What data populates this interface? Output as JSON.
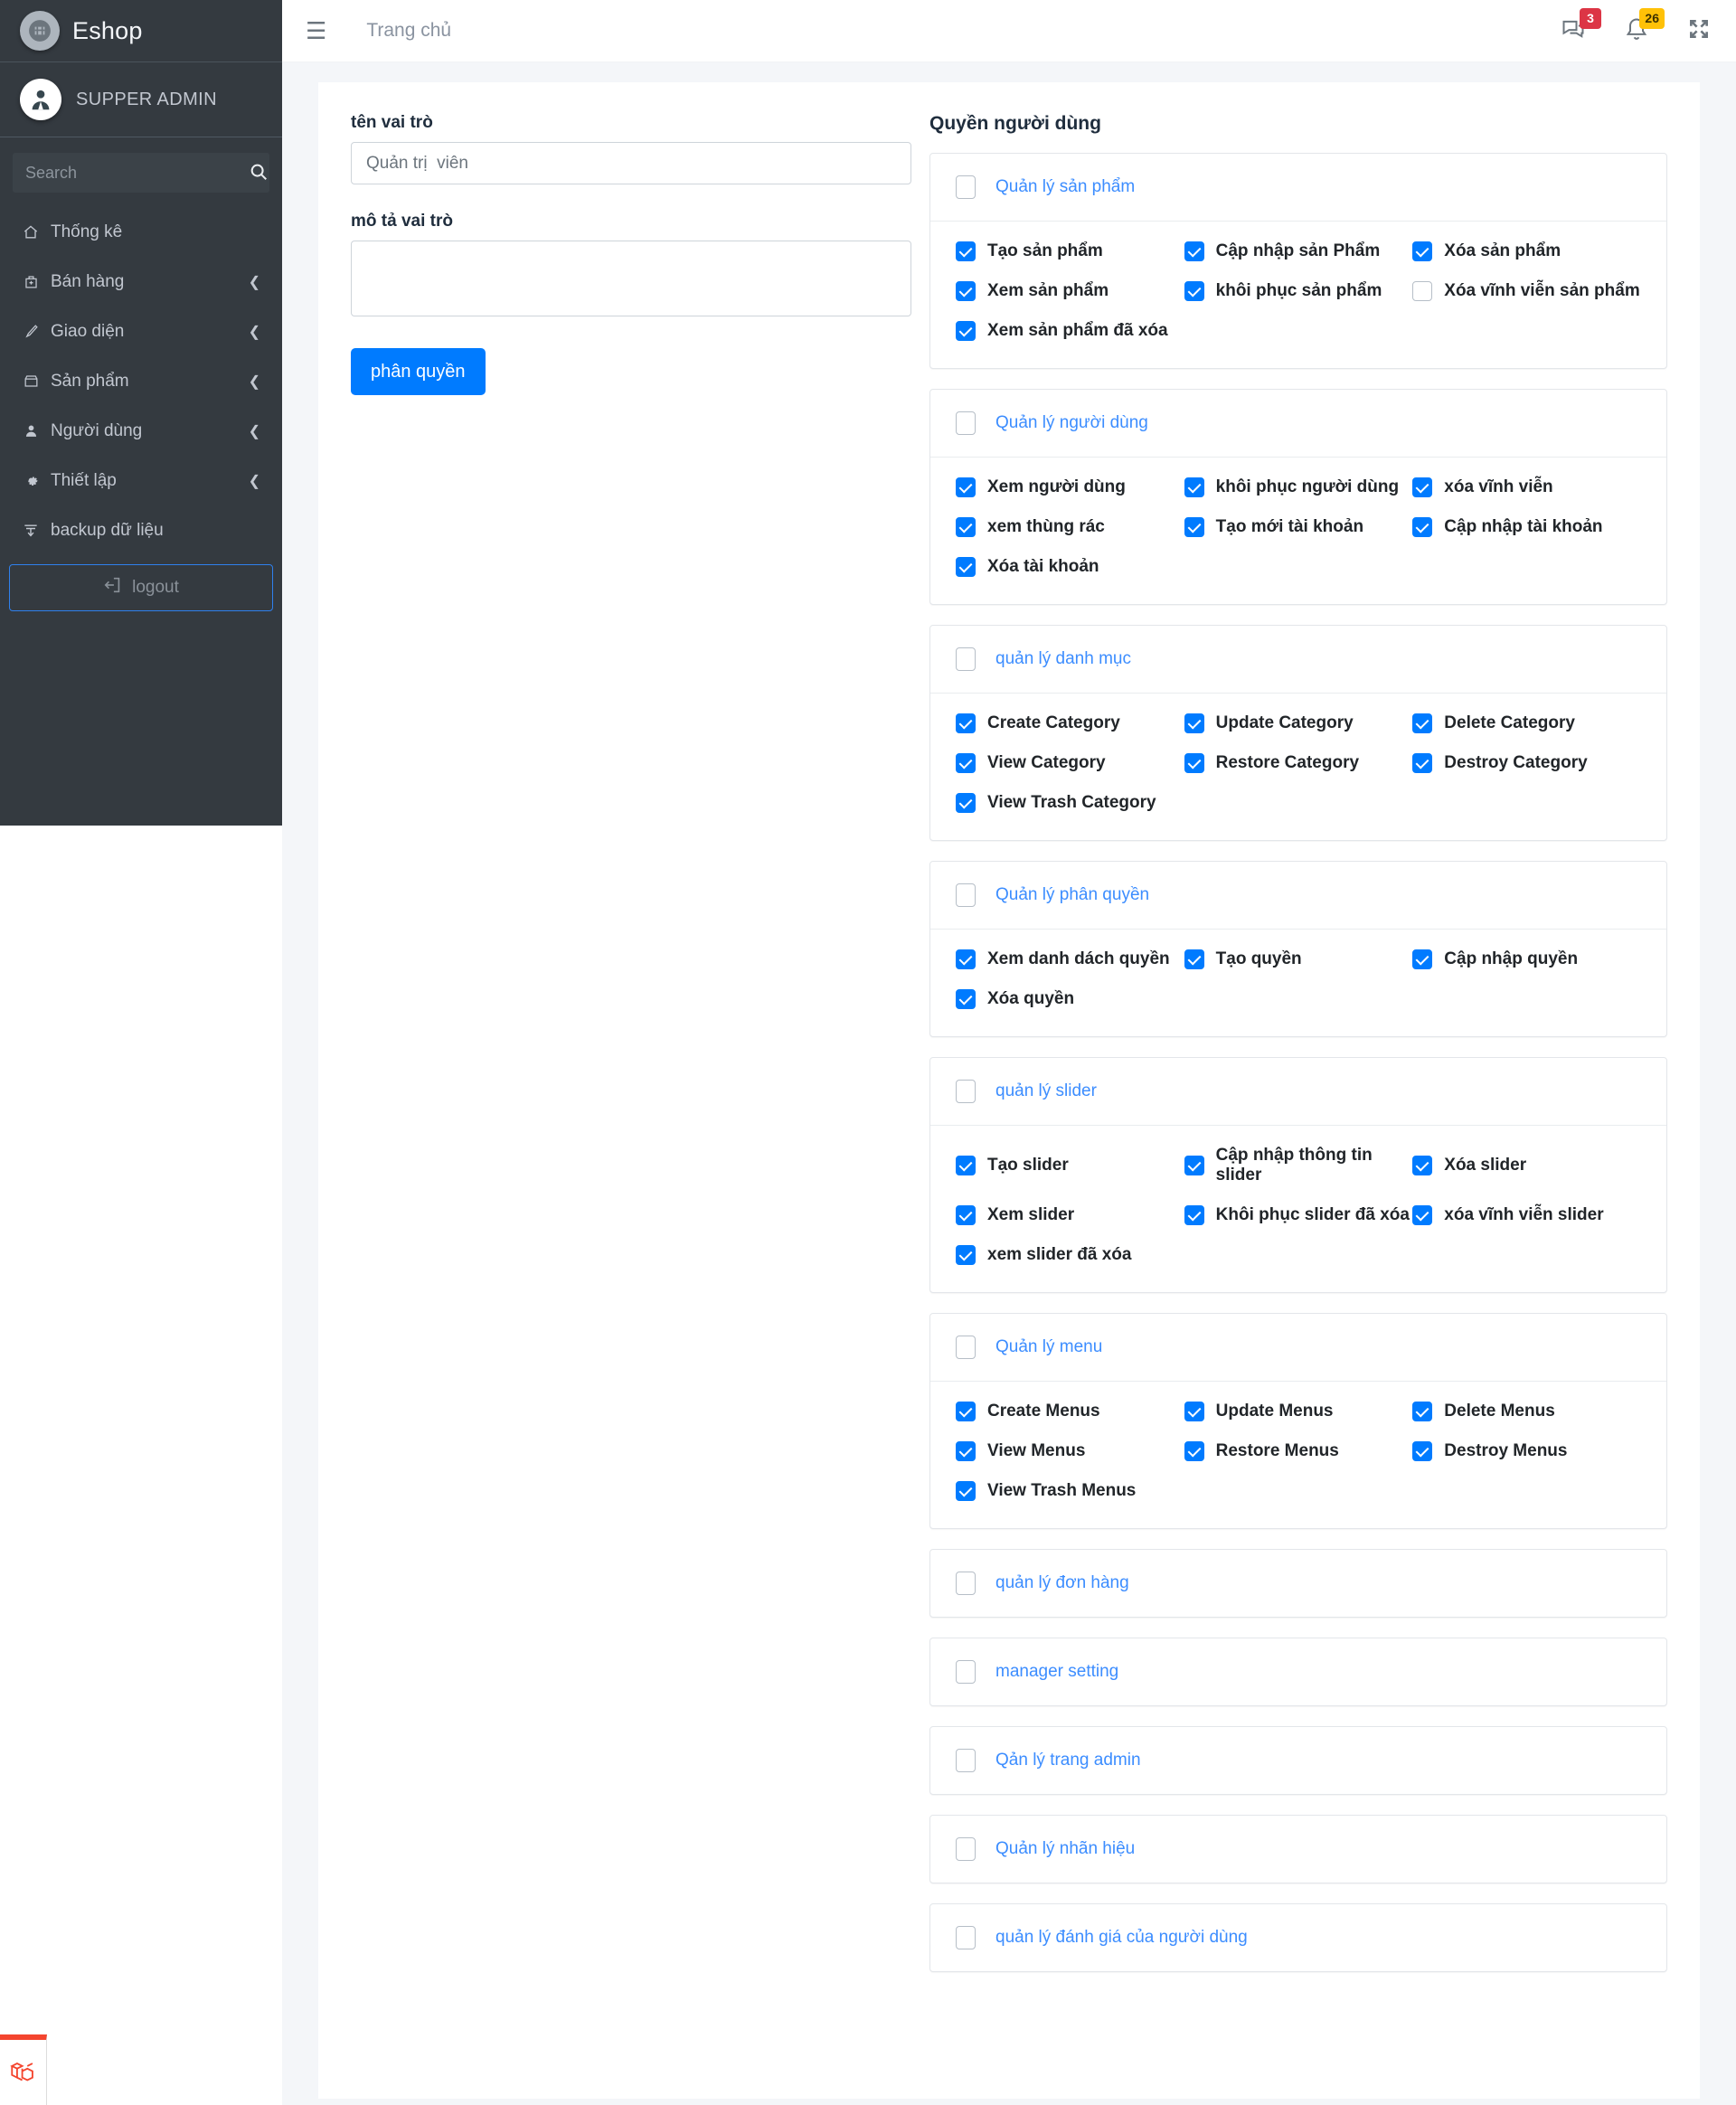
{
  "app": {
    "brand_name": "Eshop",
    "user_name": "SUPPER ADMIN"
  },
  "sidebar": {
    "search_placeholder": "Search",
    "items": [
      {
        "label": "Thống kê",
        "icon": "home-icon",
        "glyph": "⌂",
        "chevron": false
      },
      {
        "label": "Bán hàng",
        "icon": "bag-icon",
        "glyph": "Ὤd",
        "chevron": true
      },
      {
        "label": "Giao diện",
        "icon": "brush-icon",
        "glyph": "╱",
        "chevron": true
      },
      {
        "label": "Sản phẩm",
        "icon": "box-icon",
        "glyph": "▢",
        "chevron": true
      },
      {
        "label": "Người dùng",
        "icon": "user-icon",
        "glyph": "●",
        "chevron": true
      },
      {
        "label": "Thiết lập",
        "icon": "gear-icon",
        "glyph": "⚙",
        "chevron": true
      },
      {
        "label": "backup dữ liệu",
        "icon": "database-download-icon",
        "glyph": "⤓",
        "chevron": false
      }
    ],
    "logout_label": "logout"
  },
  "topbar": {
    "home_label": "Trang chủ",
    "messages_count": "3",
    "notifications_count": "26",
    "messages_badge_color": "#dc3545",
    "notifications_badge_color": "#ffc107"
  },
  "form": {
    "role_name_label": "tên vai trò",
    "role_name_placeholder": "Quản trị  viên",
    "role_name_value": "",
    "role_desc_label": "mô tả vai trò",
    "role_desc_value": "",
    "submit_label": "phân quyền",
    "accent_color": "#007bff"
  },
  "permissions": {
    "title": "Quyền người dùng",
    "groups": [
      {
        "label": "Quản lý sản phẩm",
        "checked": false,
        "items": [
          {
            "label": "Tạo sản phẩm",
            "checked": true
          },
          {
            "label": "Cập nhập sản Phẩm",
            "checked": true
          },
          {
            "label": "Xóa sản phẩm",
            "checked": true
          },
          {
            "label": "Xem sản phẩm",
            "checked": true
          },
          {
            "label": "khôi phục sản phẩm",
            "checked": true
          },
          {
            "label": "Xóa vĩnh viễn sản phẩm",
            "checked": false
          },
          {
            "label": "Xem sản phẩm đã xóa",
            "checked": true
          }
        ]
      },
      {
        "label": "Quản lý người dùng",
        "checked": false,
        "items": [
          {
            "label": "Xem người dùng",
            "checked": true
          },
          {
            "label": "khôi phục người dùng",
            "checked": true
          },
          {
            "label": "xóa vĩnh viễn",
            "checked": true
          },
          {
            "label": "xem thùng rác",
            "checked": true
          },
          {
            "label": "Tạo mới tài khoản",
            "checked": true
          },
          {
            "label": "Cập nhập tài khoản",
            "checked": true
          },
          {
            "label": "Xóa tài khoản",
            "checked": true
          }
        ]
      },
      {
        "label": "quản lý danh mục",
        "checked": false,
        "items": [
          {
            "label": "Create Category",
            "checked": true
          },
          {
            "label": "Update Category",
            "checked": true
          },
          {
            "label": "Delete Category",
            "checked": true
          },
          {
            "label": "View Category",
            "checked": true
          },
          {
            "label": "Restore Category",
            "checked": true
          },
          {
            "label": "Destroy Category",
            "checked": true
          },
          {
            "label": "View Trash Category",
            "checked": true
          }
        ]
      },
      {
        "label": "Quản lý phân quyền",
        "checked": false,
        "items": [
          {
            "label": "Xem danh dách quyền",
            "checked": true
          },
          {
            "label": "Tạo quyền",
            "checked": true
          },
          {
            "label": "Cập nhập quyền",
            "checked": true
          },
          {
            "label": "Xóa quyền",
            "checked": true
          }
        ]
      },
      {
        "label": "quản lý slider",
        "checked": false,
        "items": [
          {
            "label": "Tạo slider",
            "checked": true
          },
          {
            "label": "Cập nhập thông tin slider",
            "checked": true
          },
          {
            "label": "Xóa slider",
            "checked": true
          },
          {
            "label": "Xem slider",
            "checked": true
          },
          {
            "label": "Khôi phục slider đã xóa",
            "checked": true
          },
          {
            "label": "xóa vĩnh viễn slider",
            "checked": true
          },
          {
            "label": "xem slider đã xóa",
            "checked": true
          }
        ]
      },
      {
        "label": "Quản lý menu",
        "checked": false,
        "items": [
          {
            "label": "Create Menus",
            "checked": true
          },
          {
            "label": "Update Menus",
            "checked": true
          },
          {
            "label": "Delete Menus",
            "checked": true
          },
          {
            "label": "View Menus",
            "checked": true
          },
          {
            "label": "Restore Menus",
            "checked": true
          },
          {
            "label": "Destroy Menus",
            "checked": true
          },
          {
            "label": "View Trash Menus",
            "checked": true
          }
        ]
      },
      {
        "label": "quản lý đơn hàng",
        "checked": false,
        "items": []
      },
      {
        "label": "manager setting",
        "checked": false,
        "items": []
      },
      {
        "label": "Qản lý trang admin",
        "checked": false,
        "items": []
      },
      {
        "label": "Quản lý nhãn hiệu",
        "checked": false,
        "items": []
      },
      {
        "label": "quản lý đánh giá của người dùng",
        "checked": false,
        "items": []
      }
    ]
  }
}
